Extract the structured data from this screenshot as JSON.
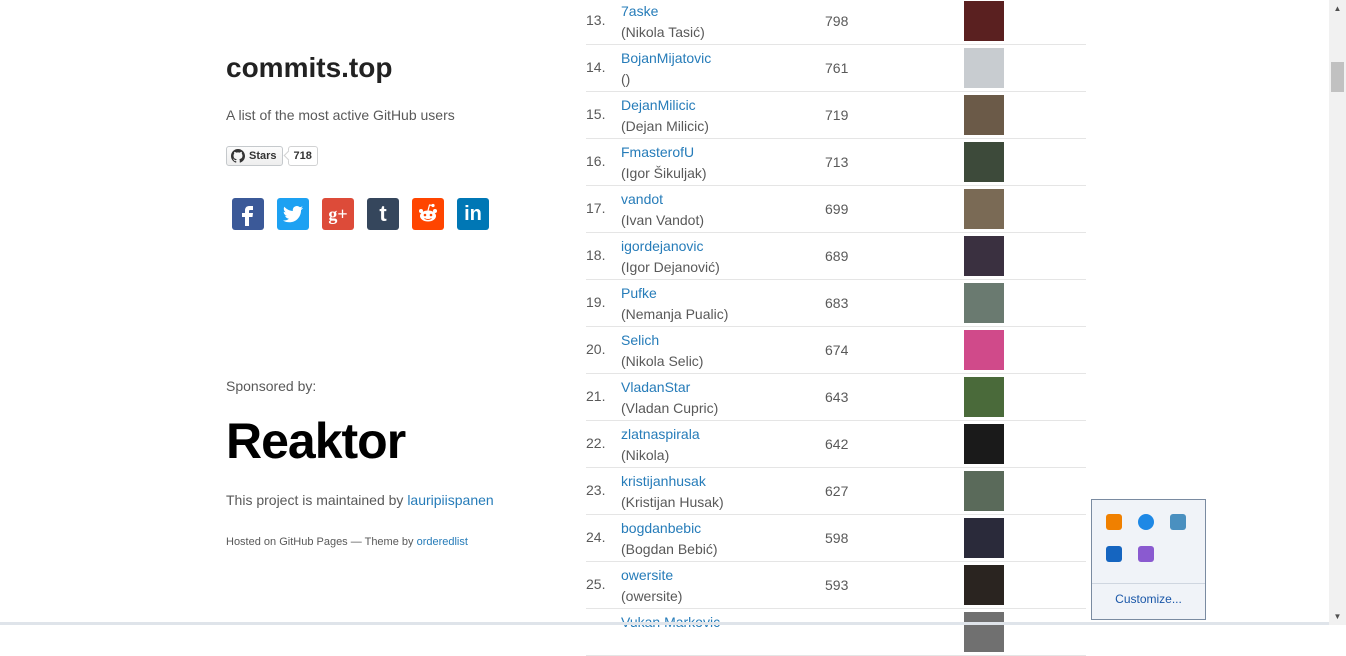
{
  "site": {
    "title": "commits.top",
    "tagline": "A list of the most active GitHub users",
    "stars_label": "Stars",
    "stars_count": "718",
    "sponsored_by": "Sponsored by:",
    "sponsor_logo_text": "Reaktor",
    "maintained_prefix": "This project is maintained by",
    "maintainer": "lauripiispanen",
    "hosted_prefix": "Hosted on GitHub Pages — Theme by",
    "theme_author": "orderedlist"
  },
  "social": [
    {
      "name": "facebook",
      "glyph": "f",
      "color": "#3b5998"
    },
    {
      "name": "twitter",
      "glyph": "t",
      "color": "#1da1f2"
    },
    {
      "name": "google-plus",
      "glyph": "g+",
      "color": "#dd4b39"
    },
    {
      "name": "tumblr",
      "glyph": "t",
      "color": "#35465c"
    },
    {
      "name": "reddit",
      "glyph": "r",
      "color": "#ff4500"
    },
    {
      "name": "linkedin",
      "glyph": "in",
      "color": "#0077b5"
    }
  ],
  "users": [
    {
      "rank": "13.",
      "login": "7aske",
      "name": "(Nikola Tasić)",
      "count": "798",
      "avatar_color": "#5a2020"
    },
    {
      "rank": "14.",
      "login": "BojanMijatovic",
      "name": "()",
      "count": "761",
      "avatar_color": "#c8ccd0"
    },
    {
      "rank": "15.",
      "login": "DejanMilicic",
      "name": "(Dejan Milicic)",
      "count": "719",
      "avatar_color": "#6b5a48"
    },
    {
      "rank": "16.",
      "login": "FmasterofU",
      "name": "(Igor Šikuljak)",
      "count": "713",
      "avatar_color": "#3d4a3a"
    },
    {
      "rank": "17.",
      "login": "vandot",
      "name": "(Ivan Vandot)",
      "count": "699",
      "avatar_color": "#7a6a55"
    },
    {
      "rank": "18.",
      "login": "igordejanovic",
      "name": "(Igor Dejanović)",
      "count": "689",
      "avatar_color": "#3a3040"
    },
    {
      "rank": "19.",
      "login": "Pufke",
      "name": "(Nemanja Pualic)",
      "count": "683",
      "avatar_color": "#6a7a70"
    },
    {
      "rank": "20.",
      "login": "Selich",
      "name": "(Nikola Selic)",
      "count": "674",
      "avatar_color": "#d04a8a"
    },
    {
      "rank": "21.",
      "login": "VladanStar",
      "name": "(Vladan Cupric)",
      "count": "643",
      "avatar_color": "#4a6a3a"
    },
    {
      "rank": "22.",
      "login": "zlatnaspirala",
      "name": "(Nikola)",
      "count": "642",
      "avatar_color": "#1a1a1a"
    },
    {
      "rank": "23.",
      "login": "kristijanhusak",
      "name": "(Kristijan Husak)",
      "count": "627",
      "avatar_color": "#5a6a5a"
    },
    {
      "rank": "24.",
      "login": "bogdanbebic",
      "name": "(Bogdan Bebić)",
      "count": "598",
      "avatar_color": "#2a2a3a"
    },
    {
      "rank": "25.",
      "login": "owersite",
      "name": "(owersite)",
      "count": "593",
      "avatar_color": "#2a2420"
    },
    {
      "rank": "",
      "login": "Vukan Markovic",
      "name": "",
      "count": "",
      "avatar_color": "#707070"
    }
  ],
  "tray": {
    "icons": [
      {
        "name": "vlc-icon",
        "color": "#f08000"
      },
      {
        "name": "sync-icon",
        "color": "#1e88e5"
      },
      {
        "name": "network-icon",
        "color": "#4a90c0"
      },
      {
        "name": "bluetooth-icon",
        "color": "#1565c0"
      },
      {
        "name": "pen-icon",
        "color": "#8a5ad0"
      }
    ],
    "customize_label": "Customize..."
  }
}
